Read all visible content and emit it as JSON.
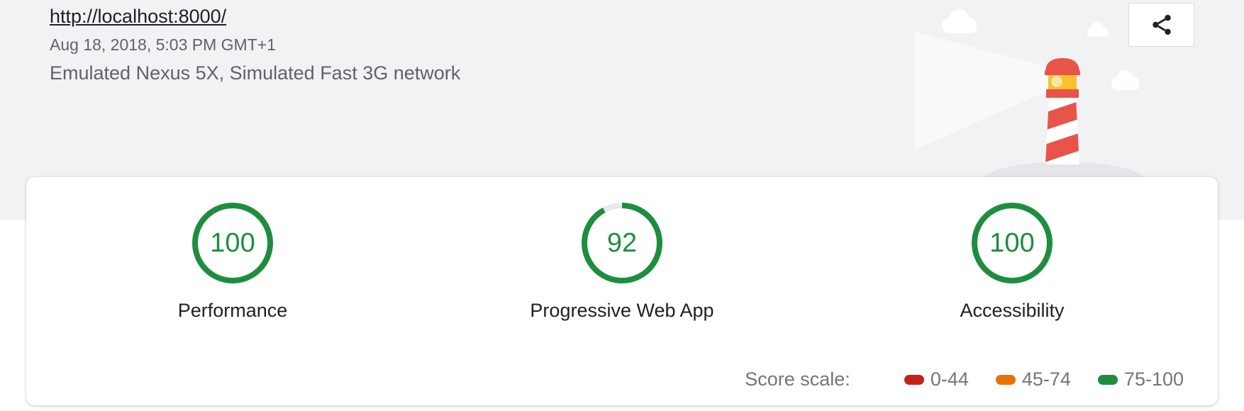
{
  "header": {
    "url": "http://localhost:8000/",
    "timestamp": "Aug 18, 2018, 5:03 PM GMT+1",
    "environment": "Emulated Nexus 5X, Simulated Fast 3G network",
    "share_icon": "share-icon"
  },
  "gauges": [
    {
      "label": "Performance",
      "score": "100",
      "value": 100,
      "color": "#1e8e3e"
    },
    {
      "label": "Progressive Web App",
      "score": "92",
      "value": 92,
      "color": "#1e8e3e"
    },
    {
      "label": "Accessibility",
      "score": "100",
      "value": 100,
      "color": "#1e8e3e"
    }
  ],
  "score_scale": {
    "title": "Score scale:",
    "ranges": [
      {
        "label": "0-44",
        "color": "#c5221f"
      },
      {
        "label": "45-74",
        "color": "#e8710a"
      },
      {
        "label": "75-100",
        "color": "#1e8e3e"
      }
    ]
  },
  "colors": {
    "header_background": "#f1f2f4",
    "lighthouse_red": "#e8544a",
    "lighthouse_lamp": "#fbc02d"
  }
}
